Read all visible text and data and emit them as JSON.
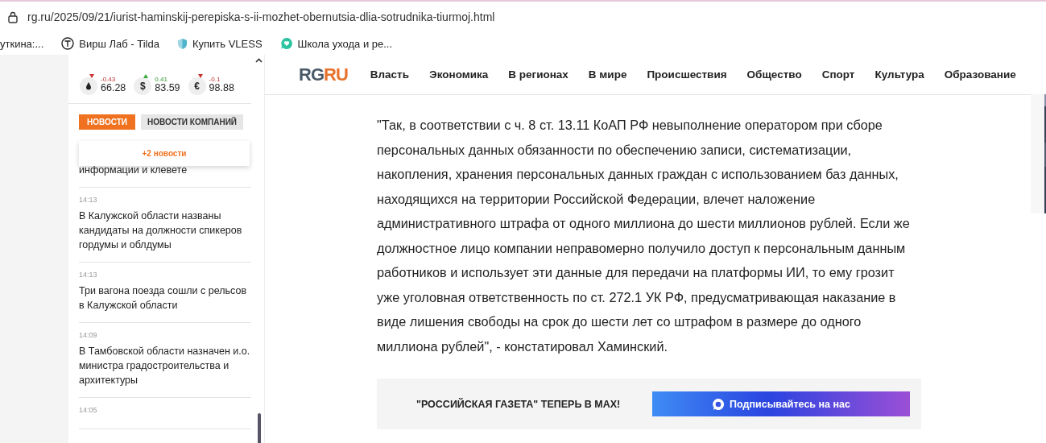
{
  "address_bar": {
    "url": "rg.ru/2025/09/21/iurist-haminskij-perepiska-s-ii-mozhet-obernutsia-dlia-sotrudnika-tiurmoj.html"
  },
  "bookmarks": [
    {
      "kind": "plain",
      "label": "уткина:..."
    },
    {
      "kind": "tilda",
      "label": "Вирш Лаб - Tilda"
    },
    {
      "kind": "shield",
      "label": "Купить VLESS"
    },
    {
      "kind": "heart",
      "label": "Школа ухода и ре..."
    }
  ],
  "rates": [
    {
      "kind": "oil",
      "rising": false,
      "change": "-0.43",
      "value": "66.28"
    },
    {
      "kind": "currency",
      "symbol": "$",
      "rising": true,
      "change": "0.41",
      "value": "83.59"
    },
    {
      "kind": "currency",
      "symbol": "€",
      "rising": false,
      "change": "-0.1",
      "value": "98.88"
    }
  ],
  "news_tabs": [
    {
      "label": "НОВОСТИ",
      "selected": true
    },
    {
      "label": "НОВОСТИ КОМПАНИЙ",
      "selected": false
    }
  ],
  "new_items_notice": "+2 новости",
  "news_items": [
    {
      "title": "информации и клевете"
    },
    {
      "time": "14:13",
      "title": "В Калужской области названы кандидаты на должности спикеров гордумы и облдумы"
    },
    {
      "time": "14:13",
      "title": "Три вагона поезда сошли с рельсов в Калужской области"
    },
    {
      "time": "14:09",
      "title": "В Тамбовской области назначен и.о. министра градостроительства и архитектуры"
    },
    {
      "time": "14:05"
    }
  ],
  "logo": {
    "left": "RG",
    "right": "RU"
  },
  "nav": [
    "Власть",
    "Экономика",
    "В регионах",
    "В мире",
    "Происшествия",
    "Общество",
    "Спорт",
    "Культура",
    "Образование"
  ],
  "article_text": "\"Так, в соответствии с ч. 8 ст. 13.11 КоАП РФ невыполнение оператором при сборе персональных данных обязанности по обеспечению записи, систематизации, накопления, хранения персональных данных граждан с использованием баз данных, находящихся на территории Российской Федерации, влечет наложение административного штрафа от одного миллиона до шести миллионов рублей. Если же должностное лицо компании неправомерно получило доступ к персональным данным работников и использует эти данные для передачи на платформы ИИ, то ему грозит уже уголовная ответственность по ст. 272.1 УК РФ, предусматривающая наказание в виде лишения свободы на срок до шести лет со штрафом в размере до одного миллиона рублей\", - констатировал Хаминский.",
  "banner": {
    "text": "\"РОССИЙСКАЯ ГАЗЕТА\" ТЕПЕРЬ В MAX!",
    "button": "Подписывайтесь на нас"
  }
}
